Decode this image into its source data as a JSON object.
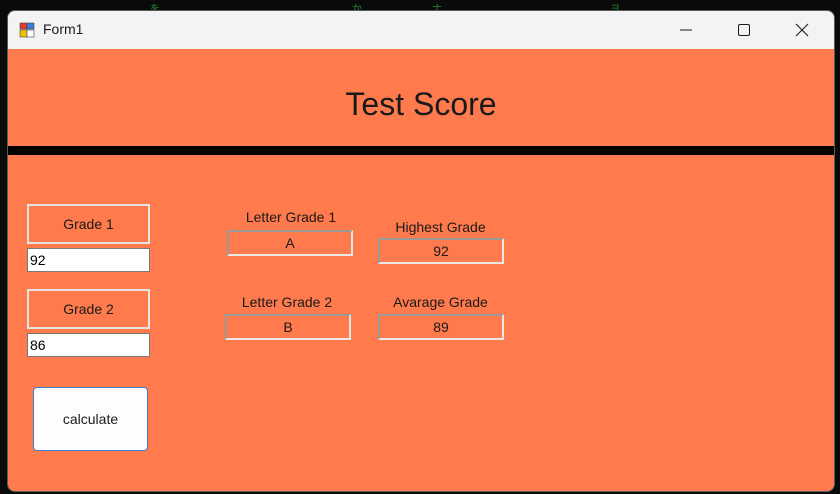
{
  "window": {
    "title": "Form1",
    "controls": [
      "minimize-icon",
      "maximize-icon",
      "close-icon"
    ]
  },
  "form": {
    "heading": "Test Score",
    "grade1_label": "Grade 1",
    "grade1_value": "92",
    "grade2_label": "Grade 2",
    "grade2_value": "86",
    "calculate_label": "calculate",
    "letter1_label": "Letter Grade 1",
    "letter1_value": "A",
    "letter2_label": "Letter Grade 2",
    "letter2_value": "B",
    "highest_label": "Highest Grade",
    "highest_value": "92",
    "average_label": "Avarage Grade",
    "average_value": "89"
  },
  "colors": {
    "form_background": "#ff7a4d",
    "divider": "#000000",
    "titlebar": "#f3f3f3",
    "button_border": "#3c7fd1"
  }
}
